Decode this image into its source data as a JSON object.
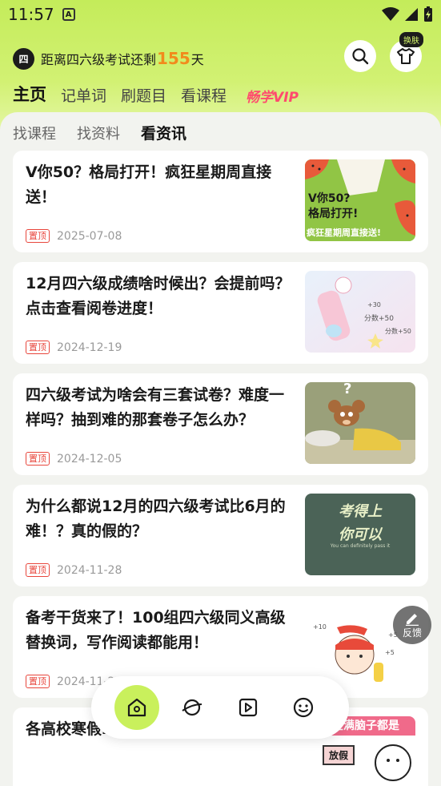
{
  "status": {
    "time": "11:57",
    "notification_icon": "A"
  },
  "countdown": {
    "badge": "四",
    "prefix": "距离四六级考试还剩",
    "days": "155",
    "suffix": "天"
  },
  "header": {
    "skin_label": "换肤"
  },
  "main_tabs": [
    "主页",
    "记单词",
    "刷题目",
    "看课程",
    "畅学VIP"
  ],
  "sub_tabs": [
    "找课程",
    "找资料",
    "看资讯"
  ],
  "articles": [
    {
      "title": "V你50？格局打开！疯狂星期周直接送！",
      "tag": "置顶",
      "date": "2025-07-08",
      "thumb_text": [
        "V你50?",
        "格局打开!",
        "疯狂星期周直接送!"
      ]
    },
    {
      "title": "12月四六级成绩啥时候出？会提前吗？点击查看阅卷进度！",
      "tag": "置顶",
      "date": "2024-12-19"
    },
    {
      "title": "四六级考试为啥会有三套试卷？难度一样吗？抽到难的那套卷子怎么办？",
      "tag": "置顶",
      "date": "2024-12-05"
    },
    {
      "title": "为什么都说12月的四六级考试比6月的难！？真的假的？",
      "tag": "置顶",
      "date": "2024-11-28",
      "thumb_text": [
        "考得上",
        "你可以",
        "You can definitely pass it"
      ]
    },
    {
      "title": "备考干货来了！100组四六级同义高级替换词，写作阅读都能用！",
      "tag": "置顶",
      "date": "2024-11-2"
    },
    {
      "title": "各高校寒假…64天！",
      "tag": "置顶",
      "date": "",
      "thumb_text": [
        "现在满脑子都是",
        "放假"
      ]
    }
  ],
  "feedback_label": "反馈",
  "nav": [
    "home-icon",
    "planet-icon",
    "video-icon",
    "smile-icon"
  ],
  "colors": {
    "accent": "#c9f05c",
    "countdown": "#f28a1c",
    "vip": "#ff4b6e",
    "pin": "#e8463c"
  }
}
